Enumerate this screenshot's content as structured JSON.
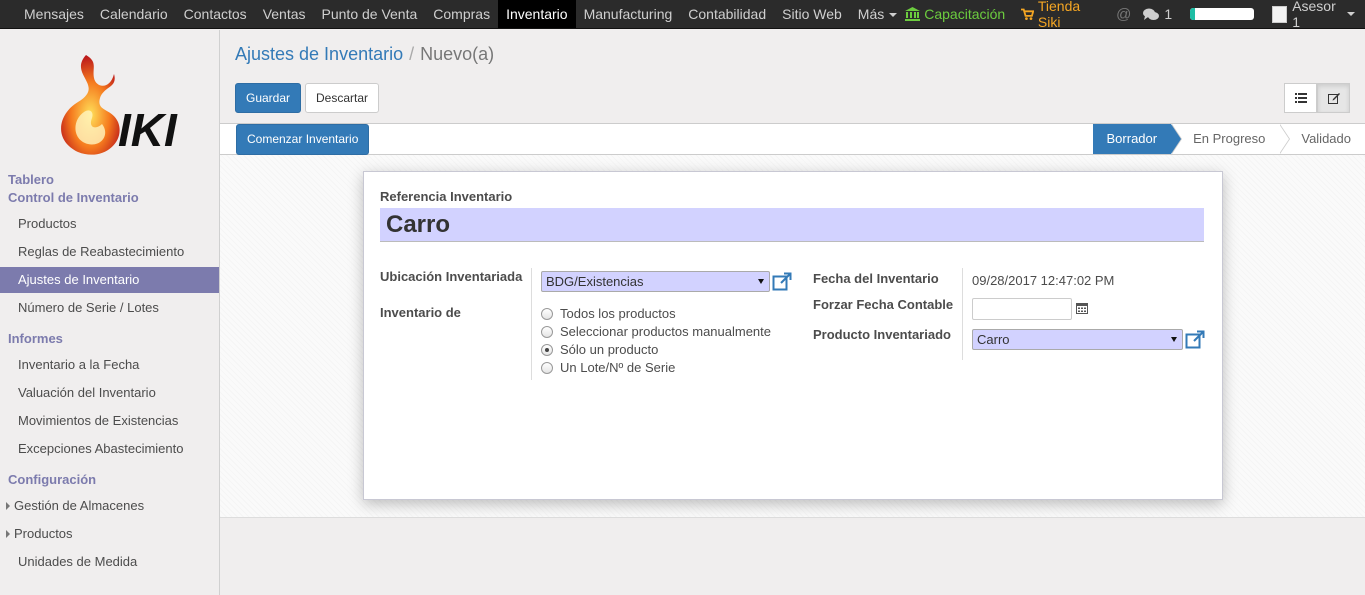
{
  "topbar": {
    "menu": [
      "Mensajes",
      "Calendario",
      "Contactos",
      "Ventas",
      "Punto de Venta",
      "Compras",
      "Inventario",
      "Manufacturing",
      "Contabilidad",
      "Sitio Web",
      "Más"
    ],
    "active_menu": "Inventario",
    "capacitacion": "Capacitación",
    "tienda": "Tienda Siki",
    "at_symbol": "@",
    "chat_count": "1",
    "progress_fraction": 0.08,
    "user": "Asesor 1",
    "colors": {
      "capacitacion": "#6ccc3f",
      "tienda": "#f5a623"
    }
  },
  "sidebar": {
    "logo_text": "IKI",
    "sections": [
      {
        "title": "Tablero"
      },
      {
        "title": "Control de Inventario",
        "items": [
          "Productos",
          "Reglas de Reabastecimiento",
          "Ajustes de Inventario",
          "Número de Serie / Lotes"
        ]
      },
      {
        "title": "Informes",
        "items": [
          "Inventario a la Fecha",
          "Valuación del Inventario",
          "Movimientos de Existencias",
          "Excepciones Abastecimiento"
        ]
      },
      {
        "title": "Configuración",
        "items": [
          "Gestión de Almacenes",
          "Productos",
          "Unidades de Medida"
        ]
      }
    ],
    "active_item": "Ajustes de Inventario",
    "accent_color": "#7c7bad"
  },
  "breadcrumb": {
    "parent": "Ajustes de Inventario",
    "separator": "/",
    "current": "Nuevo(a)"
  },
  "buttons": {
    "save": "Guardar",
    "discard": "Descartar",
    "start": "Comenzar Inventario"
  },
  "stages": [
    "Borrador",
    "En Progreso",
    "Validado"
  ],
  "active_stage": "Borrador",
  "form": {
    "ref_label": "Referencia Inventario",
    "ref_value": "Carro",
    "location_label": "Ubicación Inventariada",
    "location_value": "BDG/Existencias",
    "inventory_of_label": "Inventario de",
    "inventory_of_options": [
      "Todos los productos",
      "Seleccionar productos manualmente",
      "Sólo un producto",
      "Un Lote/Nº de Serie"
    ],
    "inventory_of_selected": "Sólo un producto",
    "date_label": "Fecha del Inventario",
    "date_value": "09/28/2017 12:47:02 PM",
    "force_date_label": "Forzar Fecha Contable",
    "force_date_value": "",
    "product_label": "Producto Inventariado",
    "product_value": "Carro"
  }
}
